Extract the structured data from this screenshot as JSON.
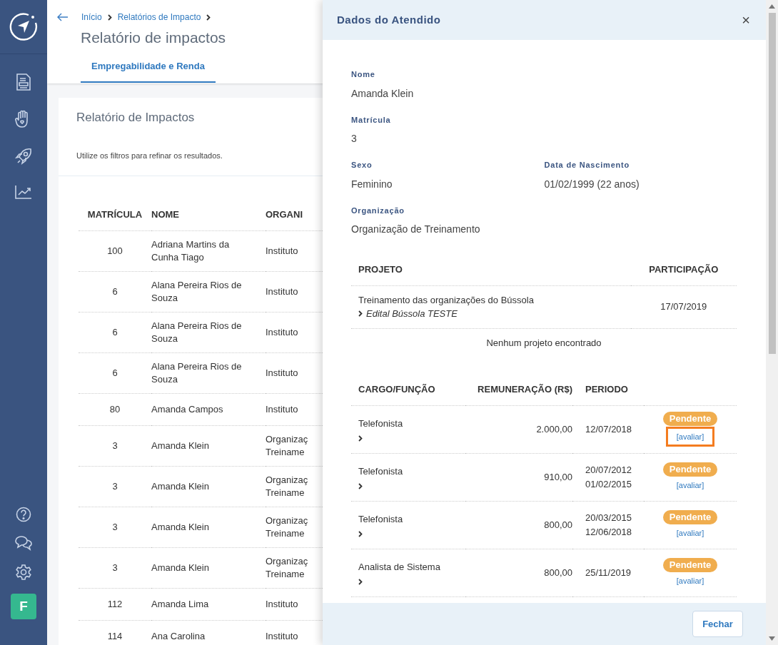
{
  "breadcrumb": [
    "Início",
    "Relatórios de Impacto"
  ],
  "page_title": "Relatório de impactos",
  "tabs": [
    {
      "label": "Empregabilidade e Renda",
      "selected": true
    }
  ],
  "card": {
    "title": "Relatório de Impactos",
    "hint": "Utilize os filtros para refinar os resultados."
  },
  "table": {
    "columns": [
      "MATRÍCULA",
      "NOME",
      "ORGANI"
    ],
    "rows": [
      {
        "matricula": "100",
        "nome": "Adriana Martins da Cunha Tiago",
        "organizacao": "Instituto"
      },
      {
        "matricula": "6",
        "nome": "Alana Pereira Rios de Souza",
        "organizacao": "Instituto"
      },
      {
        "matricula": "6",
        "nome": "Alana Pereira Rios de Souza",
        "organizacao": "Instituto"
      },
      {
        "matricula": "6",
        "nome": "Alana Pereira Rios de Souza",
        "organizacao": "Instituto"
      },
      {
        "matricula": "80",
        "nome": "Amanda Campos",
        "organizacao": "Instituto"
      },
      {
        "matricula": "3",
        "nome": "Amanda Klein",
        "organizacao": "Organizaç\nTreiname"
      },
      {
        "matricula": "3",
        "nome": "Amanda Klein",
        "organizacao": "Organizaç\nTreiname"
      },
      {
        "matricula": "3",
        "nome": "Amanda Klein",
        "organizacao": "Organizaç\nTreiname"
      },
      {
        "matricula": "3",
        "nome": "Amanda Klein",
        "organizacao": "Organizaç\nTreiname"
      },
      {
        "matricula": "112",
        "nome": "Amanda Lima",
        "organizacao": "Instituto"
      },
      {
        "matricula": "114",
        "nome": "Ana Carolina",
        "organizacao": "Instituto"
      }
    ]
  },
  "sidebar": {
    "avatar": "F"
  },
  "modal": {
    "title": "Dados do Atendido",
    "close": "×",
    "fields": [
      {
        "label": "Nome",
        "value": "Amanda Klein"
      },
      {
        "label": "Matrícula",
        "value": "3"
      },
      {
        "label": "Sexo",
        "value": "Feminino"
      },
      {
        "label": "Data de Nascimento",
        "value": "01/02/1999 (22 anos)"
      },
      {
        "label": "Organização",
        "value": "Organização de Treinamento"
      }
    ],
    "projects": {
      "columns": [
        "PROJETO",
        "PARTICIPAÇÃO"
      ],
      "rows": [
        {
          "name": "Treinamento das organizações do Bússola",
          "edital": "Edital Bússola TESTE",
          "date": "17/07/2019"
        }
      ],
      "empty": "Nenhum projeto encontrado"
    },
    "jobs": {
      "columns": [
        "CARGO/FUNÇÃO",
        "REMUNERAÇÃO (R$)",
        "PERIODO"
      ],
      "rows": [
        {
          "role": "Telefonista",
          "pay": "2.000,00",
          "period": [
            "12/07/2018"
          ],
          "status": "Pendente",
          "action": "[avaliar]",
          "highlighted": true
        },
        {
          "role": "Telefonista",
          "pay": "910,00",
          "period": [
            "20/07/2012",
            "01/02/2015"
          ],
          "status": "Pendente",
          "action": "[avaliar]",
          "highlighted": false
        },
        {
          "role": "Telefonista",
          "pay": "800,00",
          "period": [
            "20/03/2015",
            "12/06/2018"
          ],
          "status": "Pendente",
          "action": "[avaliar]",
          "highlighted": false
        },
        {
          "role": "Analista de Sistema",
          "pay": "800,00",
          "period": [
            "25/11/2019"
          ],
          "status": "Pendente",
          "action": "[avaliar]",
          "highlighted": false
        }
      ]
    },
    "button": "Fechar"
  }
}
